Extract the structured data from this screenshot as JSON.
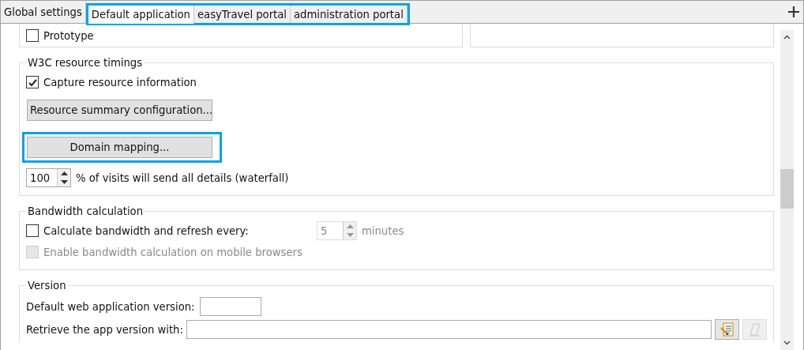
{
  "tabs": [
    {
      "label": "Global settings",
      "selected": false,
      "highlighted": false
    },
    {
      "label": "Default application",
      "selected": true,
      "highlighted": true
    },
    {
      "label": "easyTravel portal",
      "selected": false,
      "highlighted": true
    },
    {
      "label": "administration portal",
      "selected": false,
      "highlighted": true
    }
  ],
  "top_section": {
    "checkboxes": [
      {
        "label": "Prototype",
        "checked": false,
        "disabled": false
      }
    ]
  },
  "groups": [
    {
      "title": "W3C resource timings",
      "items": [
        {
          "kind": "checkbox",
          "label": "Capture resource information",
          "checked": true,
          "disabled": false
        },
        {
          "kind": "button",
          "label": "Resource summary configuration...",
          "highlighted": false
        },
        {
          "kind": "button",
          "label": "Domain mapping...",
          "highlighted": true
        },
        {
          "kind": "spinner",
          "value": "100",
          "label": "% of visits will send all details (waterfall)",
          "disabled": false
        }
      ]
    },
    {
      "title": "Bandwidth calculation",
      "items": [
        {
          "kind": "checkbox_spinner",
          "label": "Calculate bandwidth and refresh every:",
          "checked": false,
          "disabled": false,
          "value": "5",
          "unit": "minutes",
          "spinner_disabled": true
        },
        {
          "kind": "checkbox",
          "label": "Enable bandwidth calculation on mobile browsers",
          "checked": false,
          "disabled": true
        }
      ]
    },
    {
      "title": "Version",
      "items": [
        {
          "kind": "text_field",
          "label": "Default web application version:"
        },
        {
          "kind": "text_field_tools",
          "label": "Retrieve the app version with:"
        }
      ]
    }
  ]
}
